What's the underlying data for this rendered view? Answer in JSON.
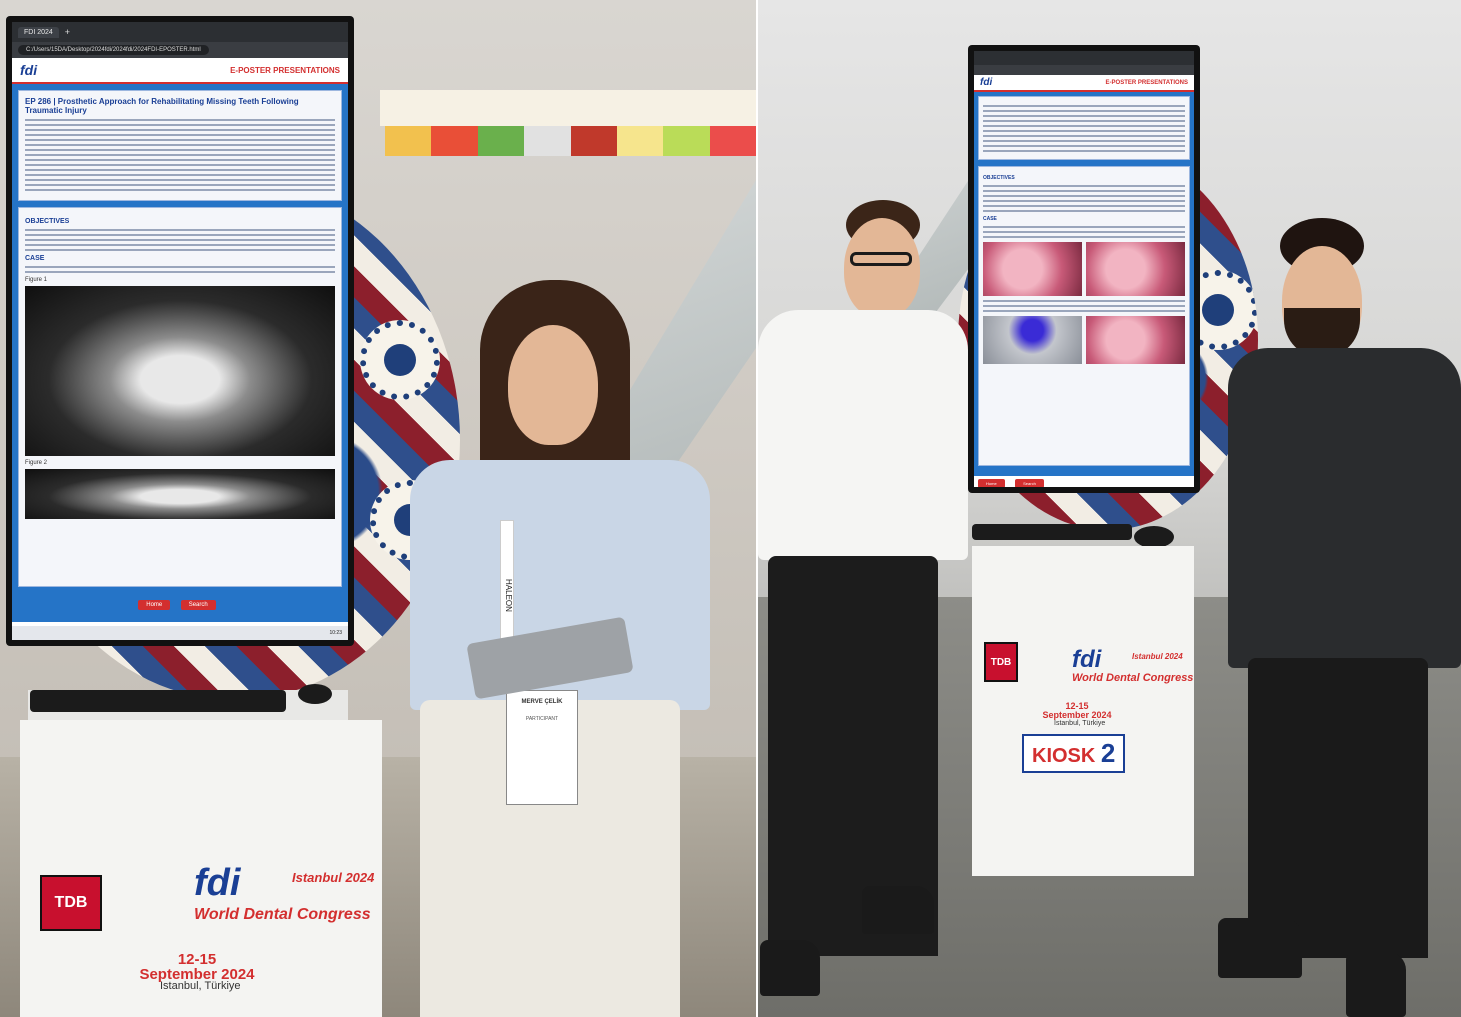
{
  "left_photo": {
    "browser": {
      "tab_title": "FDI 2024",
      "address": "C:/Users/15DA/Desktop/2024fdi/2024fdi/2024FDI-EPOSTER.html"
    },
    "poster": {
      "logo": "fdi",
      "banner": "E-POSTER PRESENTATIONS",
      "title": "EP 286 | Prosthetic Approach for Rehabilitating Missing Teeth Following Traumatic Injury",
      "section_objectives": "OBJECTIVES",
      "section_case": "CASE",
      "figure1_label": "Figure 1",
      "figure2_label": "Figure 2",
      "btn_home": "Home",
      "btn_search": "Search"
    },
    "taskbar_time": "10:23",
    "stand": {
      "tdb": "TDB",
      "fdi": "fdi",
      "city_script": "Istanbul 2024",
      "congress": "World Dental Congress",
      "dates_days": "12-15",
      "dates_month": "September 2024",
      "city": "Istanbul, Türkiye"
    },
    "badge": {
      "name": "MERVE ÇELİK",
      "role": "PARTICIPANT"
    },
    "lanyard_text": "HALEON"
  },
  "right_photo": {
    "poster": {
      "logo": "fdi",
      "banner": "E-POSTER PRESENTATIONS",
      "section_objectives": "OBJECTIVES",
      "section_case": "CASE",
      "btn_home": "Home",
      "btn_search": "Search"
    },
    "stand": {
      "tdb": "TDB",
      "fdi": "fdi",
      "city_script": "Istanbul 2024",
      "congress": "World Dental Congress",
      "dates_days": "12-15",
      "dates_month": "September 2024",
      "city": "Istanbul, Türkiye",
      "kiosk_word": "KIOSK",
      "kiosk_number": "2"
    }
  }
}
